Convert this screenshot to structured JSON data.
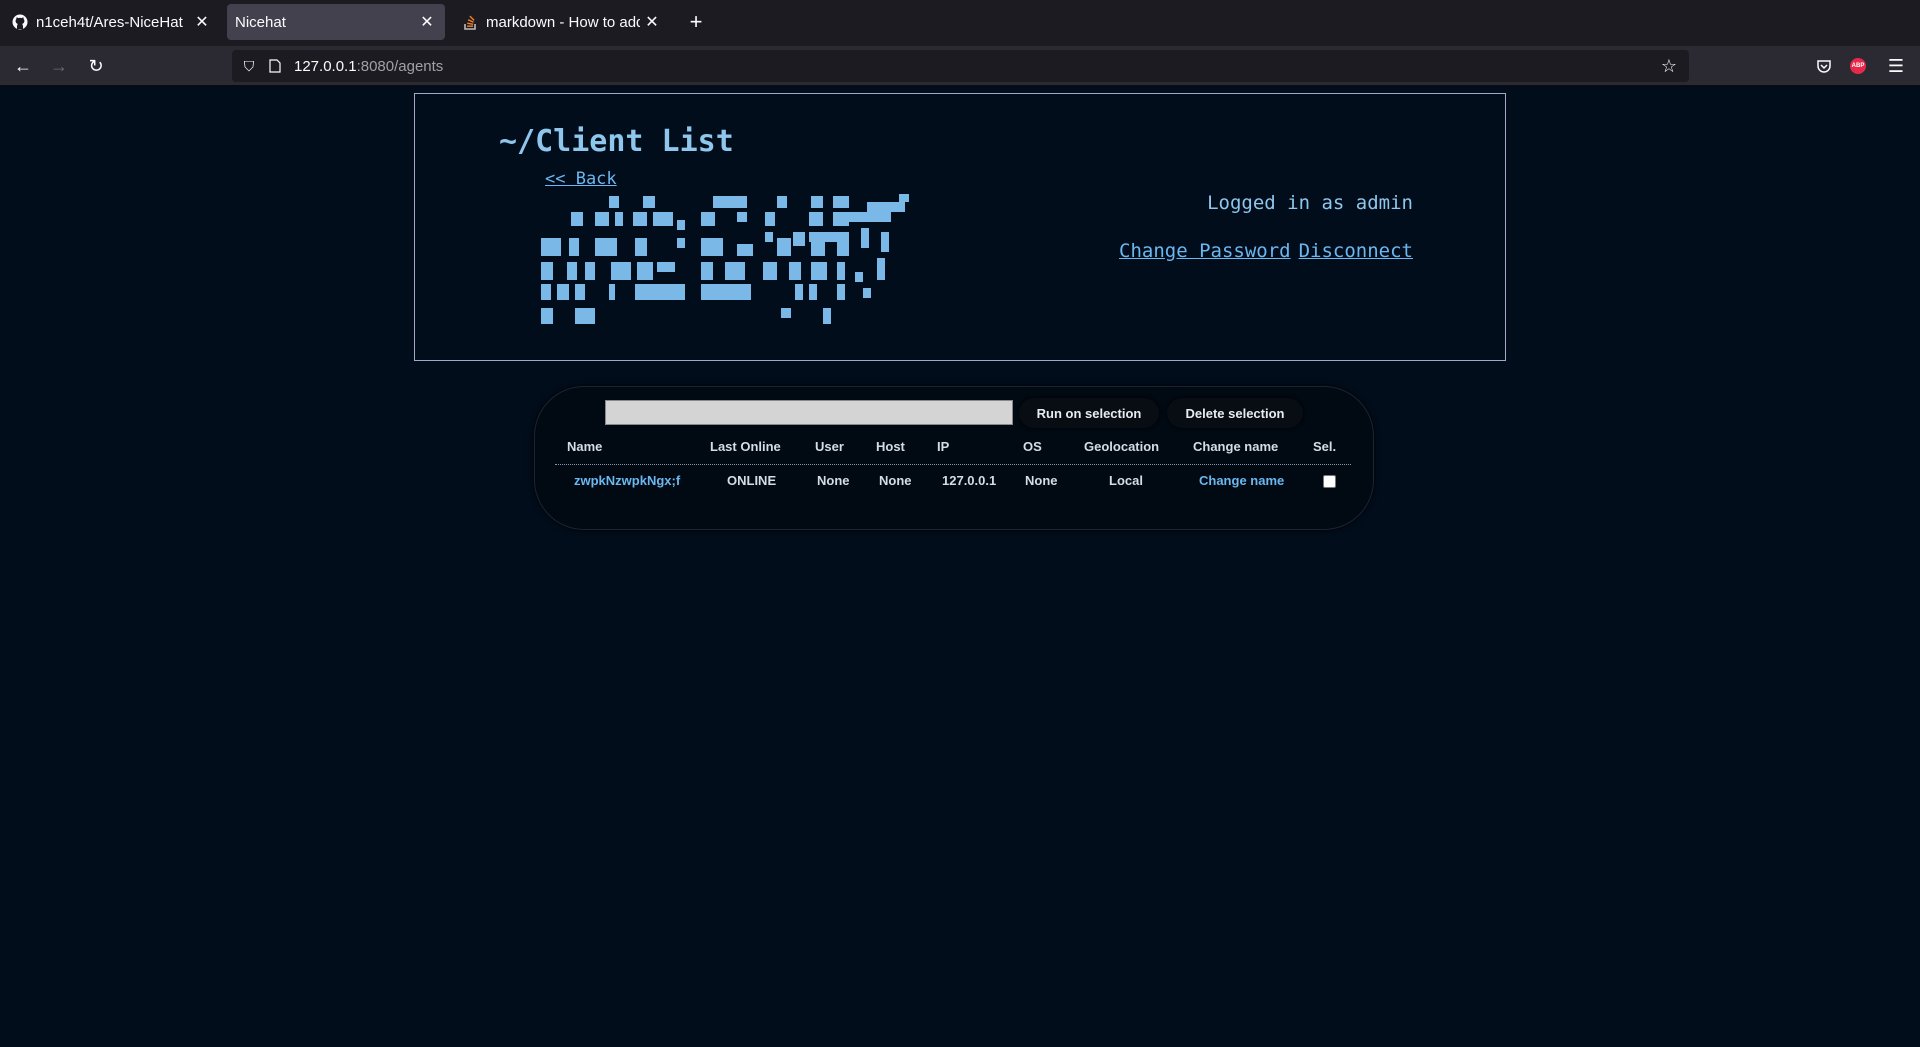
{
  "browser": {
    "tabs": [
      {
        "label": "n1ceh4t/Ares-NiceHat",
        "icon": "github-icon",
        "active": false
      },
      {
        "label": "Nicehat",
        "icon": "none",
        "active": true
      },
      {
        "label": "markdown - How to add im",
        "icon": "stackoverflow-icon",
        "active": false
      }
    ],
    "new_tab": "+",
    "url_host": "127.0.0.1",
    "url_rest": ":8080/agents"
  },
  "header": {
    "title": "~/Client List",
    "back_link": "<< Back",
    "logo_text": "NiceHat",
    "logged_in": "Logged in as admin",
    "change_password": "Change Password",
    "disconnect": "Disconnect"
  },
  "toolbar": {
    "command_value": "",
    "run_label": "Run on selection",
    "delete_label": "Delete selection"
  },
  "table": {
    "headers": [
      "Name",
      "Last Online",
      "User",
      "Host",
      "IP",
      "OS",
      "Geolocation",
      "Change name",
      "Sel."
    ],
    "rows": [
      {
        "name": "zwpkNzwpkNgx;f",
        "last_online": "ONLINE",
        "user": "None",
        "host": "None",
        "ip": "127.0.0.1",
        "os": "None",
        "geolocation": "Local",
        "change_name": "Change name",
        "selected": false
      }
    ]
  },
  "colors": {
    "background": "#020d1c",
    "accent": "#6bb7f0",
    "logo": "#7ab8e8"
  }
}
